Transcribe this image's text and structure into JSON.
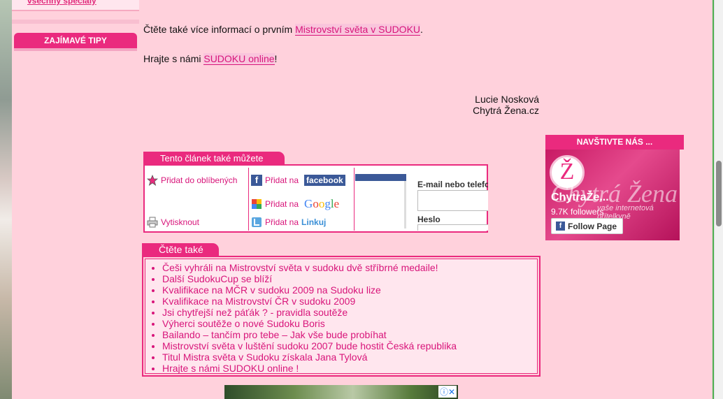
{
  "sidebar": {
    "top_link": "všechny speciály",
    "heading": "ZAJÍMAVÉ TIPY"
  },
  "article": {
    "line1_prefix": "Čtěte také více informací o prvním ",
    "line1_link": "Mistrovství světa v SUDOKU",
    "line1_suffix": ".",
    "line2_prefix": "Hrajte s námi ",
    "line2_link": "SUDOKU online",
    "line2_suffix": "!",
    "author": "Lucie Nosková",
    "publication": "Chytrá Žena.cz"
  },
  "share": {
    "title": "Tento článek také můžete",
    "add_favorites": "Přidat do oblíbených",
    "print": "Vytisknout",
    "add_to": "Přidat na",
    "facebook": "facebook",
    "google": "Google",
    "linkuj": "Linkuj",
    "email_label": "E-mail nebo telefon",
    "password_label": "Heslo"
  },
  "read_also": {
    "title": "Čtěte také",
    "items": [
      "Češi vyhráli na Mistrovství světa v sudoku dvě stříbrné medaile!",
      "Další SudokuCup se blíží",
      "Kvalifikace na MČR v sudoku 2009 na Sudoku lize",
      "Kvalifikace na Mistrovství ČR v sudoku 2009",
      "Jsi chytřejší než páťák ? - pravidla soutěže",
      "Výherci soutěže o nové Sudoku Boris",
      "Bailando – tančím pro tebe – Jak vše bude probíhat",
      "Mistrovství světa v luštění sudoku 2007 bude hostit Česká republika",
      "Titul Mistra světa v Sudoku získala Jana Tylová",
      "Hrajte s námi SUDOKU online !"
    ]
  },
  "facebook_widget": {
    "heading": "NAVŠTIVTE NÁS ...",
    "logo_letter": "Ž",
    "brand_script": "Chytrá Žena",
    "tagline": "vaše internetová přítelkyně",
    "page_name": "ChytraŽe...",
    "followers": "9.7K followers",
    "follow_button": "Follow Page"
  },
  "ad": {
    "icons": "ⓘ✕"
  },
  "colors": {
    "accent": "#ea2a7e",
    "background": "#ffd1dc",
    "link": "#d8157a"
  }
}
